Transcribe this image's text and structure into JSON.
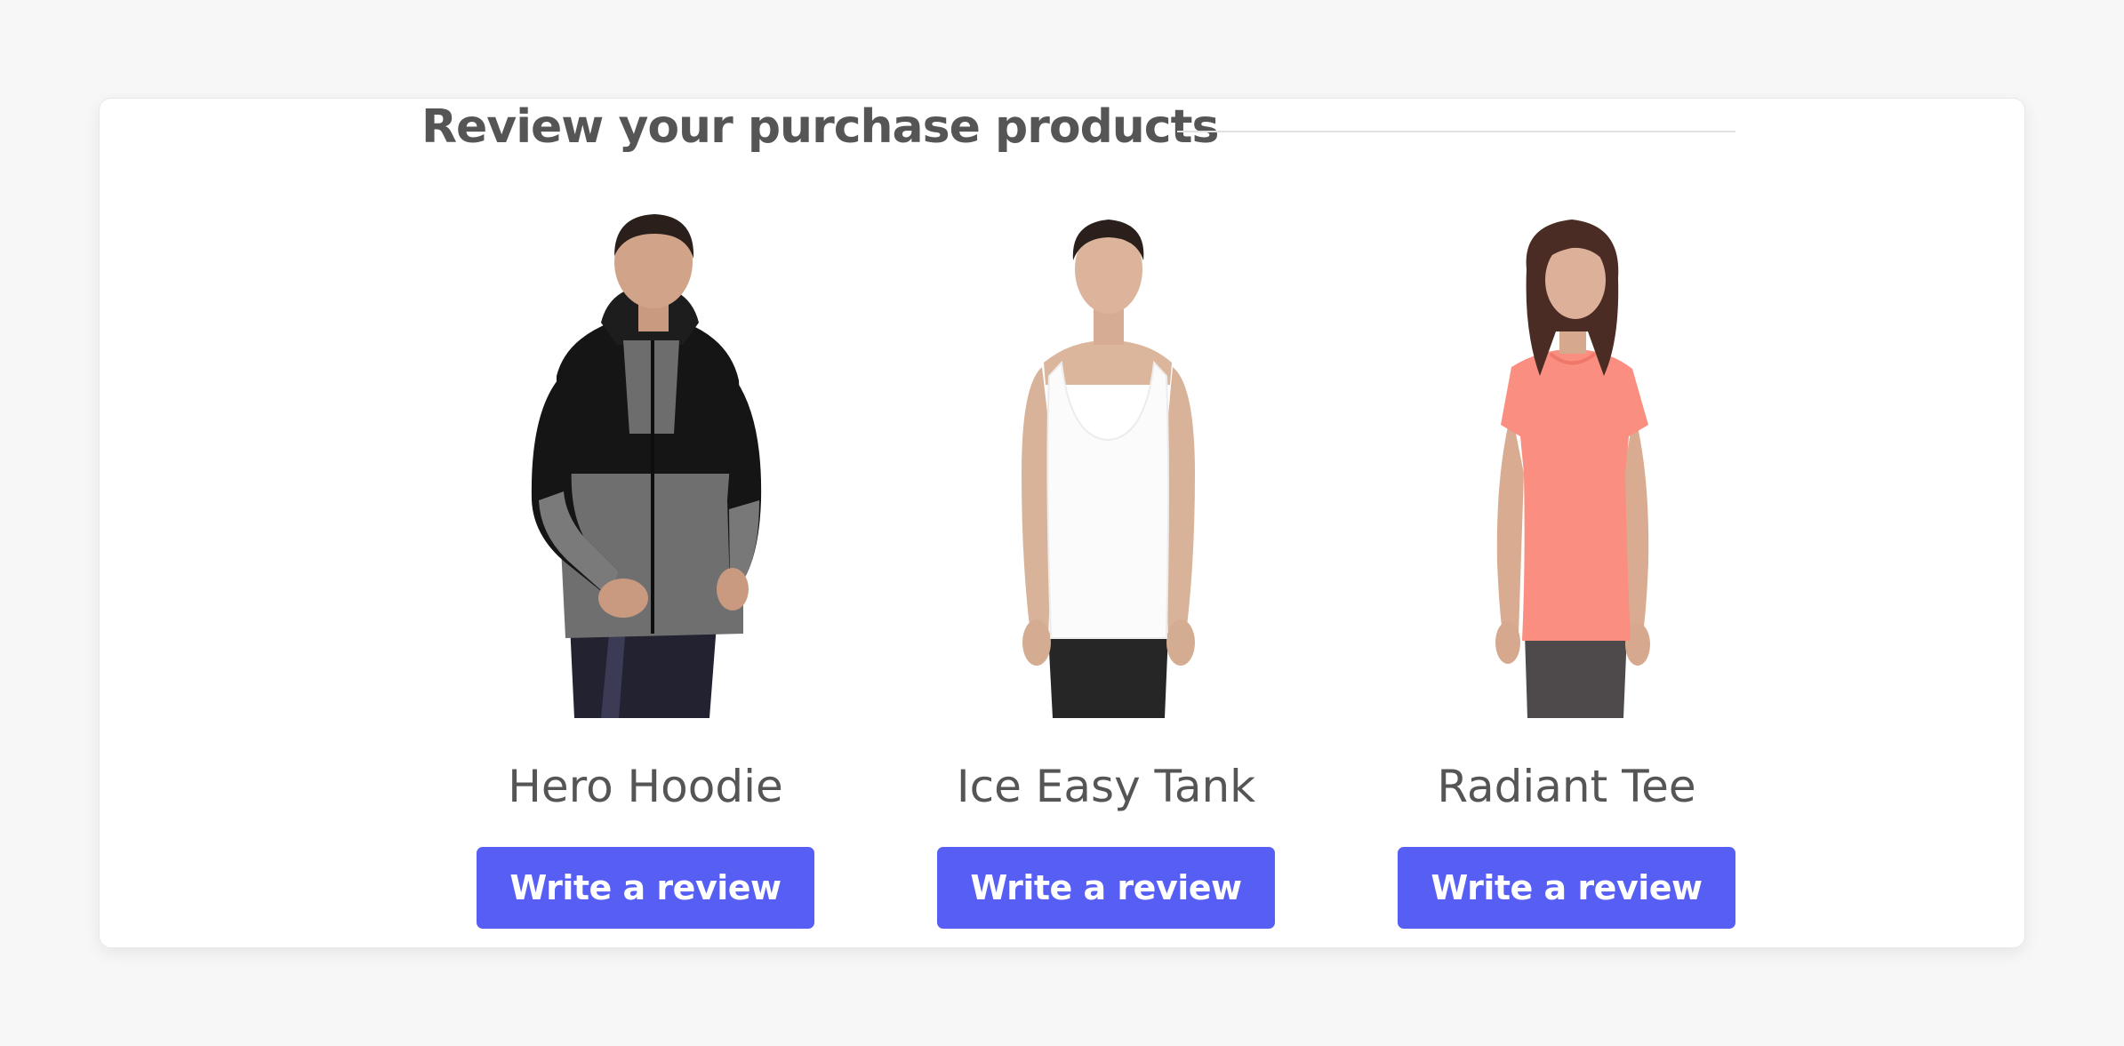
{
  "section": {
    "title": "Review your purchase products"
  },
  "products": [
    {
      "name": "Hero Hoodie",
      "button_label": "Write a review",
      "image_icon": "person-hoodie-image",
      "colors": {
        "garment_top": "#151515",
        "garment_body": "#6f6f6f",
        "pants": "#222230"
      }
    },
    {
      "name": "Ice Easy Tank",
      "button_label": "Write a review",
      "image_icon": "person-tank-image",
      "colors": {
        "garment_body": "#fbfbfb",
        "pants": "#262626"
      }
    },
    {
      "name": "Radiant Tee",
      "button_label": "Write a review",
      "image_icon": "person-tee-image",
      "colors": {
        "garment_body": "#fa8e80",
        "pants": "#4e4a4c"
      }
    }
  ],
  "colors": {
    "accent": "#565ef3",
    "title_text": "#555555",
    "page_background": "#f7f7f7",
    "card_background": "#ffffff"
  }
}
